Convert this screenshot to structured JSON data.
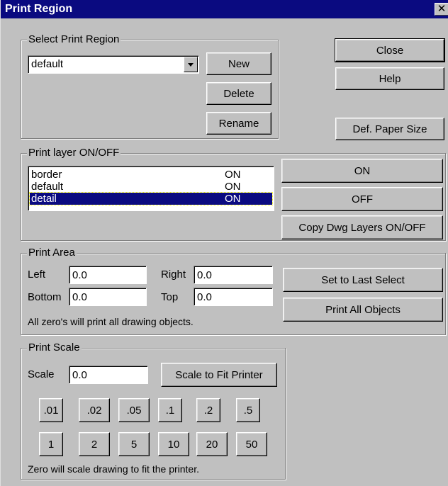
{
  "window": {
    "title": "Print Region",
    "close_glyph": "✕"
  },
  "region": {
    "group_label": "Select Print Region",
    "selected": "default",
    "buttons": {
      "new": "New",
      "delete": "Delete",
      "rename": "Rename"
    }
  },
  "side_buttons": {
    "close": "Close",
    "help": "Help",
    "def_paper": "Def. Paper Size"
  },
  "layers": {
    "group_label": "Print layer ON/OFF",
    "items": [
      {
        "name": "border",
        "state": "ON",
        "selected": false
      },
      {
        "name": "default",
        "state": "ON",
        "selected": false
      },
      {
        "name": "detail",
        "state": "ON",
        "selected": true
      }
    ],
    "buttons": {
      "on": "ON",
      "off": "OFF",
      "copy": "Copy Dwg Layers ON/OFF"
    }
  },
  "area": {
    "group_label": "Print Area",
    "left_label": "Left",
    "left_value": "0.0",
    "right_label": "Right",
    "right_value": "0.0",
    "bottom_label": "Bottom",
    "bottom_value": "0.0",
    "top_label": "Top",
    "top_value": "0.0",
    "note": "All zero's will print all drawing objects.",
    "buttons": {
      "last_select": "Set to Last Select",
      "all_objects": "Print All Objects"
    }
  },
  "scale": {
    "group_label": "Print Scale",
    "scale_label": "Scale",
    "scale_value": "0.0",
    "fit_button": "Scale to Fit Printer",
    "presets_row1": [
      ".01",
      ".02",
      ".05",
      ".1",
      ".2",
      ".5"
    ],
    "presets_row2": [
      "1",
      "2",
      "5",
      "10",
      "20",
      "50"
    ],
    "note": "Zero will scale drawing to fit the printer."
  }
}
